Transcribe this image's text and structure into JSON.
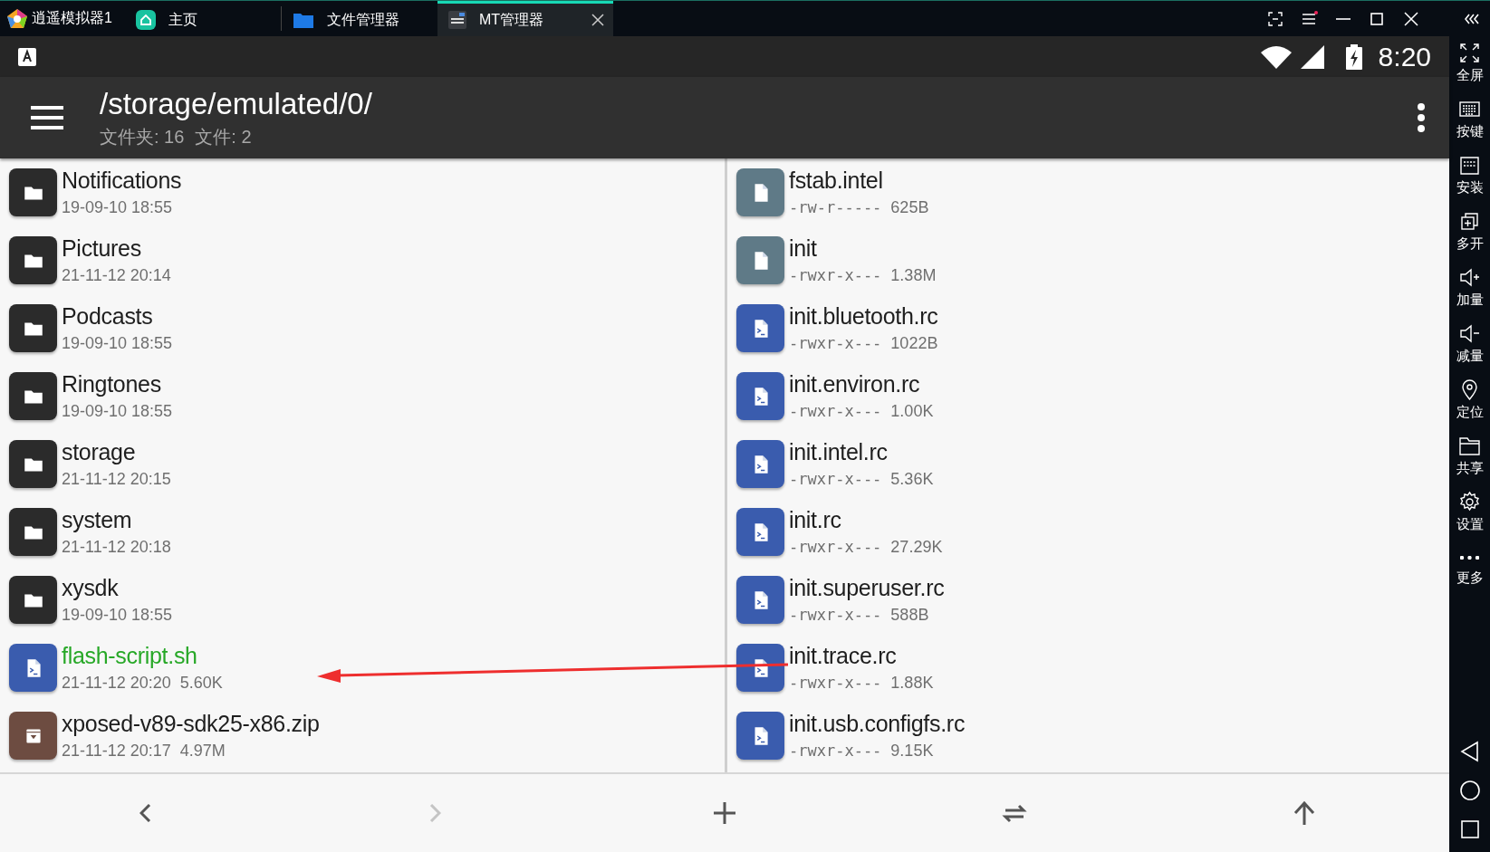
{
  "emulator": {
    "title": "逍遥模拟器1",
    "tabs": [
      {
        "kind": "home",
        "label": "主页",
        "selected": false
      },
      {
        "kind": "folder",
        "label": "文件管理器",
        "selected": false
      },
      {
        "kind": "app",
        "label": "MT管理器",
        "selected": true
      }
    ]
  },
  "status_bar": {
    "time": "8:20"
  },
  "toolbar": {
    "path": "/storage/emulated/0/",
    "folders": "文件夹: 16",
    "files": "文件: 2"
  },
  "left_panel": {
    "items": [
      {
        "kind": "folder",
        "name": "Notifications",
        "date": "19-09-10 18:55",
        "highlighted": false
      },
      {
        "kind": "folder",
        "name": "Pictures",
        "date": "21-11-12 20:14",
        "highlighted": false
      },
      {
        "kind": "folder",
        "name": "Podcasts",
        "date": "19-09-10 18:55",
        "highlighted": false
      },
      {
        "kind": "folder",
        "name": "Ringtones",
        "date": "19-09-10 18:55",
        "highlighted": false
      },
      {
        "kind": "folder",
        "name": "storage",
        "date": "21-11-12 20:15",
        "highlighted": false
      },
      {
        "kind": "folder",
        "name": "system",
        "date": "21-11-12 20:18",
        "highlighted": false
      },
      {
        "kind": "folder",
        "name": "xysdk",
        "date": "19-09-10 18:55",
        "highlighted": false
      },
      {
        "kind": "script",
        "name": "flash-script.sh",
        "date": "21-11-12 20:20",
        "size": "5.60K",
        "highlighted": true
      },
      {
        "kind": "archive",
        "name": "xposed-v89-sdk25-x86.zip",
        "date": "21-11-12 20:17",
        "size": "4.97M",
        "highlighted": false
      }
    ]
  },
  "right_panel": {
    "items": [
      {
        "kind": "file",
        "name": "fstab.intel",
        "permissions": "-rw-r-----",
        "size": "625B"
      },
      {
        "kind": "file",
        "name": "init",
        "permissions": "-rwxr-x---",
        "size": "1.38M"
      },
      {
        "kind": "script",
        "name": "init.bluetooth.rc",
        "permissions": "-rwxr-x---",
        "size": "1022B"
      },
      {
        "kind": "script",
        "name": "init.environ.rc",
        "permissions": "-rwxr-x---",
        "size": "1.00K"
      },
      {
        "kind": "script",
        "name": "init.intel.rc",
        "permissions": "-rwxr-x---",
        "size": "5.36K"
      },
      {
        "kind": "script",
        "name": "init.rc",
        "permissions": "-rwxr-x---",
        "size": "27.29K"
      },
      {
        "kind": "script",
        "name": "init.superuser.rc",
        "permissions": "-rwxr-x---",
        "size": "588B"
      },
      {
        "kind": "script",
        "name": "init.trace.rc",
        "permissions": "-rwxr-x---",
        "size": "1.88K"
      },
      {
        "kind": "script",
        "name": "init.usb.configfs.rc",
        "permissions": "-rwxr-x---",
        "size": "9.15K"
      }
    ]
  },
  "bottom_bar": {
    "buttons": [
      {
        "kind": "back",
        "disabled": false
      },
      {
        "kind": "forward",
        "disabled": true
      },
      {
        "kind": "add",
        "disabled": false
      },
      {
        "kind": "swap",
        "disabled": false
      },
      {
        "kind": "up",
        "disabled": false
      }
    ]
  },
  "sidebar": {
    "items": [
      {
        "kind": "fullscreen",
        "label": "全屏"
      },
      {
        "kind": "keyboard",
        "label": "按键"
      },
      {
        "kind": "install",
        "label": "安装"
      },
      {
        "kind": "multi",
        "label": "多开"
      },
      {
        "kind": "volup",
        "label": "加量"
      },
      {
        "kind": "voldown",
        "label": "减量"
      },
      {
        "kind": "location",
        "label": "定位"
      },
      {
        "kind": "share",
        "label": "共享"
      },
      {
        "kind": "settings",
        "label": "设置"
      },
      {
        "kind": "more",
        "label": "更多"
      }
    ]
  }
}
